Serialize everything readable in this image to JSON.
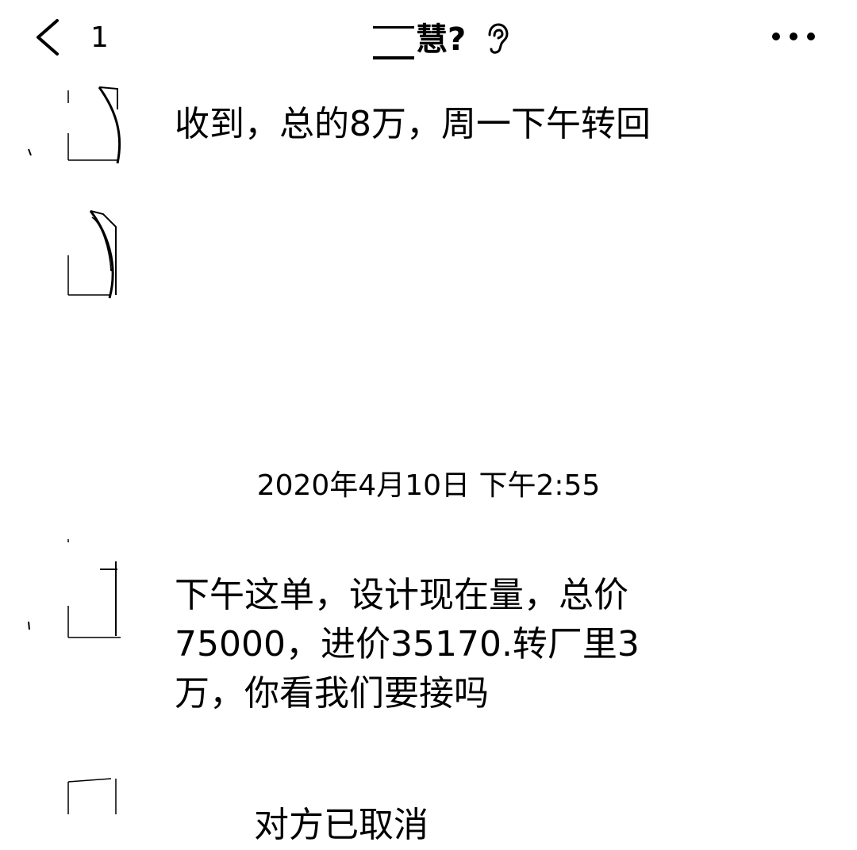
{
  "header": {
    "unread_count": "1",
    "title": "慧?",
    "back_icon": "chevron-left-icon",
    "ear_icon": "ear-icon",
    "more_icon": "more-icon"
  },
  "messages": [
    {
      "text": "收到，总的8万，周一下午转回"
    },
    {
      "text": ""
    },
    {
      "text": "下午这单，设计现在量，总价\n75000，进价35170.转厂里3\n万，你看我们要接吗"
    },
    {
      "text": "对方已取消"
    }
  ],
  "timestamp": "2020年4月10日 下午2:55"
}
